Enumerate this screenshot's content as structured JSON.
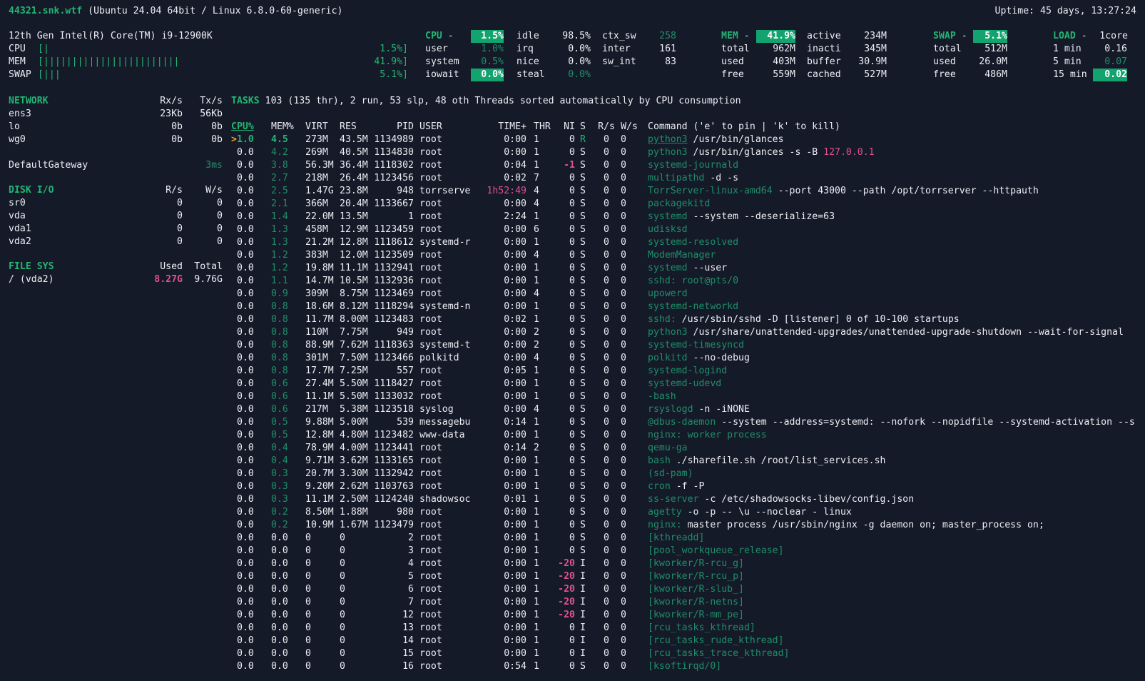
{
  "header": {
    "hostname": "44321.snk.wtf",
    "os": "(Ubuntu 24.04 64bit / Linux 6.8.0-60-generic)",
    "uptime": "Uptime: 45 days, 13:27:24"
  },
  "quicklook": {
    "cpu_model": "12th Gen Intel(R) Core(TM) i9-12900K",
    "bars": [
      {
        "label": "CPU",
        "bar": "[|",
        "value": "1.5%]"
      },
      {
        "label": "MEM",
        "bar": "[||||||||||||||||||||||||",
        "value": "41.9%]"
      },
      {
        "label": "SWAP",
        "bar": "[|||",
        "value": "5.1%]"
      }
    ]
  },
  "cpu": {
    "title": "CPU",
    "dash": "-",
    "total": "1.5%",
    "col1": [
      {
        "k": "user",
        "v": "1.0%"
      },
      {
        "k": "system",
        "v": "0.5%"
      },
      {
        "k": "iowait",
        "v": "0.0%"
      }
    ],
    "col2": [
      {
        "k": "idle",
        "v": "98.5%"
      },
      {
        "k": "irq",
        "v": "0.0%"
      },
      {
        "k": "nice",
        "v": "0.0%"
      },
      {
        "k": "steal",
        "v": "0.0%"
      }
    ],
    "col3": [
      {
        "k": "ctx_sw",
        "v": "258"
      },
      {
        "k": "inter",
        "v": "161"
      },
      {
        "k": "sw_int",
        "v": "83"
      }
    ]
  },
  "mem": {
    "title": "MEM",
    "dash": "-",
    "percent": "41.9%",
    "col1": [
      {
        "k": "total",
        "v": "962M"
      },
      {
        "k": "used",
        "v": "403M"
      },
      {
        "k": "free",
        "v": "559M"
      }
    ],
    "col2": [
      {
        "k": "active",
        "v": "234M"
      },
      {
        "k": "inacti",
        "v": "345M"
      },
      {
        "k": "buffer",
        "v": "30.9M"
      },
      {
        "k": "cached",
        "v": "527M"
      }
    ]
  },
  "swap": {
    "title": "SWAP",
    "dash": "-",
    "percent": "5.1%",
    "rows": [
      {
        "k": "total",
        "v": "512M"
      },
      {
        "k": "used",
        "v": "26.0M"
      },
      {
        "k": "free",
        "v": "486M"
      }
    ]
  },
  "load": {
    "title": "LOAD",
    "dash": "-",
    "cores": "1core",
    "rows": [
      {
        "k": "1 min",
        "v": "0.16"
      },
      {
        "k": "5 min",
        "v": "0.07"
      },
      {
        "k": "15 min",
        "v": "0.02"
      }
    ]
  },
  "network": {
    "title": "NETWORK",
    "rx": "Rx/s",
    "tx": "Tx/s",
    "rows": [
      {
        "name": "ens3",
        "rx": "23Kb",
        "tx": "56Kb"
      },
      {
        "name": "lo",
        "rx": "0b",
        "tx": "0b"
      },
      {
        "name": "wg0",
        "rx": "0b",
        "tx": "0b"
      }
    ]
  },
  "gateway": {
    "label": "DefaultGateway",
    "value": "3ms"
  },
  "diskio": {
    "title": "DISK I/O",
    "r": "R/s",
    "w": "W/s",
    "rows": [
      {
        "name": "sr0",
        "r": "0",
        "w": "0"
      },
      {
        "name": "vda",
        "r": "0",
        "w": "0"
      },
      {
        "name": "vda1",
        "r": "0",
        "w": "0"
      },
      {
        "name": "vda2",
        "r": "0",
        "w": "0"
      }
    ]
  },
  "filesys": {
    "title": "FILE SYS",
    "used": "Used",
    "total": "Total",
    "rows": [
      {
        "name": "/ (vda2)",
        "used": "8.27G",
        "total": "9.76G"
      }
    ]
  },
  "tasks": {
    "label": "TASKS",
    "summary": "103 (135 thr), 2 run, 53 slp, 48 oth Threads sorted automatically by CPU consumption"
  },
  "process_table": {
    "headers": {
      "cpu": "CPU%",
      "mem": "MEM%",
      "virt": "VIRT",
      "res": "RES",
      "pid": "PID",
      "user": "USER",
      "time": "TIME+",
      "thr": "THR",
      "ni": "NI",
      "s": "S",
      "rs": "R/s",
      "ws": "W/s",
      "cmd": "Command ('e' to pin | 'k' to kill)"
    },
    "marker": ">",
    "rows": [
      {
        "cpu": "1.0",
        "mem": "4.5",
        "virt": "273M",
        "res": "43.5M",
        "pid": "1134989",
        "user": "root",
        "time": "0:00",
        "thr": "1",
        "ni": "0",
        "s": "R",
        "rs": "0",
        "ws": "0",
        "prog": "python3",
        "args": "/usr/bin/glances"
      },
      {
        "cpu": "0.0",
        "mem": "4.2",
        "virt": "269M",
        "res": "40.5M",
        "pid": "1134830",
        "user": "root",
        "time": "0:00",
        "thr": "1",
        "ni": "0",
        "s": "S",
        "rs": "0",
        "ws": "0",
        "prog": "python3",
        "args": "/usr/bin/glances -s -B ",
        "extra": "127.0.0.1"
      },
      {
        "cpu": "0.0",
        "mem": "3.8",
        "virt": "56.3M",
        "res": "36.4M",
        "pid": "1118302",
        "user": "root",
        "time": "0:04",
        "thr": "1",
        "ni": "-1",
        "s": "S",
        "rs": "0",
        "ws": "0",
        "prog": "systemd-journald",
        "args": ""
      },
      {
        "cpu": "0.0",
        "mem": "2.7",
        "virt": "218M",
        "res": "26.4M",
        "pid": "1123456",
        "user": "root",
        "time": "0:02",
        "thr": "7",
        "ni": "0",
        "s": "S",
        "rs": "0",
        "ws": "0",
        "prog": "multipathd",
        "args": "-d -s"
      },
      {
        "cpu": "0.0",
        "mem": "2.5",
        "virt": "1.47G",
        "res": "23.8M",
        "pid": "948",
        "user": "torrserve",
        "time": "1h52:49",
        "thr": "4",
        "ni": "0",
        "s": "S",
        "rs": "0",
        "ws": "0",
        "prog": "TorrServer-linux-amd64",
        "args": "--port 43000 --path /opt/torrserver --httpauth"
      },
      {
        "cpu": "0.0",
        "mem": "2.1",
        "virt": "366M",
        "res": "20.4M",
        "pid": "1133667",
        "user": "root",
        "time": "0:00",
        "thr": "4",
        "ni": "0",
        "s": "S",
        "rs": "0",
        "ws": "0",
        "prog": "packagekitd",
        "args": ""
      },
      {
        "cpu": "0.0",
        "mem": "1.4",
        "virt": "22.0M",
        "res": "13.5M",
        "pid": "1",
        "user": "root",
        "time": "2:24",
        "thr": "1",
        "ni": "0",
        "s": "S",
        "rs": "0",
        "ws": "0",
        "prog": "systemd",
        "args": "--system --deserialize=63"
      },
      {
        "cpu": "0.0",
        "mem": "1.3",
        "virt": "458M",
        "res": "12.9M",
        "pid": "1123459",
        "user": "root",
        "time": "0:00",
        "thr": "6",
        "ni": "0",
        "s": "S",
        "rs": "0",
        "ws": "0",
        "prog": "udisksd",
        "args": ""
      },
      {
        "cpu": "0.0",
        "mem": "1.3",
        "virt": "21.2M",
        "res": "12.8M",
        "pid": "1118612",
        "user": "systemd-r",
        "time": "0:00",
        "thr": "1",
        "ni": "0",
        "s": "S",
        "rs": "0",
        "ws": "0",
        "prog": "systemd-resolved",
        "args": ""
      },
      {
        "cpu": "0.0",
        "mem": "1.2",
        "virt": "383M",
        "res": "12.0M",
        "pid": "1123509",
        "user": "root",
        "time": "0:00",
        "thr": "4",
        "ni": "0",
        "s": "S",
        "rs": "0",
        "ws": "0",
        "prog": "ModemManager",
        "args": ""
      },
      {
        "cpu": "0.0",
        "mem": "1.2",
        "virt": "19.8M",
        "res": "11.1M",
        "pid": "1132941",
        "user": "root",
        "time": "0:00",
        "thr": "1",
        "ni": "0",
        "s": "S",
        "rs": "0",
        "ws": "0",
        "prog": "systemd",
        "args": "--user"
      },
      {
        "cpu": "0.0",
        "mem": "1.1",
        "virt": "14.7M",
        "res": "10.5M",
        "pid": "1132936",
        "user": "root",
        "time": "0:00",
        "thr": "1",
        "ni": "0",
        "s": "S",
        "rs": "0",
        "ws": "0",
        "prog": "sshd: root@pts/0",
        "args": ""
      },
      {
        "cpu": "0.0",
        "mem": "0.9",
        "virt": "309M",
        "res": "8.75M",
        "pid": "1123469",
        "user": "root",
        "time": "0:00",
        "thr": "4",
        "ni": "0",
        "s": "S",
        "rs": "0",
        "ws": "0",
        "prog": "upowerd",
        "args": ""
      },
      {
        "cpu": "0.0",
        "mem": "0.8",
        "virt": "18.6M",
        "res": "8.12M",
        "pid": "1118294",
        "user": "systemd-n",
        "time": "0:00",
        "thr": "1",
        "ni": "0",
        "s": "S",
        "rs": "0",
        "ws": "0",
        "prog": "systemd-networkd",
        "args": ""
      },
      {
        "cpu": "0.0",
        "mem": "0.8",
        "virt": "11.7M",
        "res": "8.00M",
        "pid": "1123483",
        "user": "root",
        "time": "0:02",
        "thr": "1",
        "ni": "0",
        "s": "S",
        "rs": "0",
        "ws": "0",
        "prog": "sshd:",
        "args": "/usr/sbin/sshd -D [listener] 0 of 10-100 startups"
      },
      {
        "cpu": "0.0",
        "mem": "0.8",
        "virt": "110M",
        "res": "7.75M",
        "pid": "949",
        "user": "root",
        "time": "0:00",
        "thr": "2",
        "ni": "0",
        "s": "S",
        "rs": "0",
        "ws": "0",
        "prog": "python3",
        "args": "/usr/share/unattended-upgrades/unattended-upgrade-shutdown --wait-for-signal"
      },
      {
        "cpu": "0.0",
        "mem": "0.8",
        "virt": "88.9M",
        "res": "7.62M",
        "pid": "1118363",
        "user": "systemd-t",
        "time": "0:00",
        "thr": "2",
        "ni": "0",
        "s": "S",
        "rs": "0",
        "ws": "0",
        "prog": "systemd-timesyncd",
        "args": ""
      },
      {
        "cpu": "0.0",
        "mem": "0.8",
        "virt": "301M",
        "res": "7.50M",
        "pid": "1123466",
        "user": "polkitd",
        "time": "0:00",
        "thr": "4",
        "ni": "0",
        "s": "S",
        "rs": "0",
        "ws": "0",
        "prog": "polkitd",
        "args": "--no-debug"
      },
      {
        "cpu": "0.0",
        "mem": "0.8",
        "virt": "17.7M",
        "res": "7.25M",
        "pid": "557",
        "user": "root",
        "time": "0:05",
        "thr": "1",
        "ni": "0",
        "s": "S",
        "rs": "0",
        "ws": "0",
        "prog": "systemd-logind",
        "args": ""
      },
      {
        "cpu": "0.0",
        "mem": "0.6",
        "virt": "27.4M",
        "res": "5.50M",
        "pid": "1118427",
        "user": "root",
        "time": "0:00",
        "thr": "1",
        "ni": "0",
        "s": "S",
        "rs": "0",
        "ws": "0",
        "prog": "systemd-udevd",
        "args": ""
      },
      {
        "cpu": "0.0",
        "mem": "0.6",
        "virt": "11.1M",
        "res": "5.50M",
        "pid": "1133032",
        "user": "root",
        "time": "0:00",
        "thr": "1",
        "ni": "0",
        "s": "S",
        "rs": "0",
        "ws": "0",
        "prog": "-bash",
        "args": ""
      },
      {
        "cpu": "0.0",
        "mem": "0.6",
        "virt": "217M",
        "res": "5.38M",
        "pid": "1123518",
        "user": "syslog",
        "time": "0:00",
        "thr": "4",
        "ni": "0",
        "s": "S",
        "rs": "0",
        "ws": "0",
        "prog": "rsyslogd",
        "args": "-n -iNONE"
      },
      {
        "cpu": "0.0",
        "mem": "0.5",
        "virt": "9.88M",
        "res": "5.00M",
        "pid": "539",
        "user": "messagebu",
        "time": "0:14",
        "thr": "1",
        "ni": "0",
        "s": "S",
        "rs": "0",
        "ws": "0",
        "prog": "@dbus-daemon",
        "args": "--system --address=systemd: --nofork --nopidfile --systemd-activation --s"
      },
      {
        "cpu": "0.0",
        "mem": "0.5",
        "virt": "12.8M",
        "res": "4.80M",
        "pid": "1123482",
        "user": "www-data",
        "time": "0:00",
        "thr": "1",
        "ni": "0",
        "s": "S",
        "rs": "0",
        "ws": "0",
        "prog": "nginx: worker process",
        "args": ""
      },
      {
        "cpu": "0.0",
        "mem": "0.4",
        "virt": "78.9M",
        "res": "4.00M",
        "pid": "1123441",
        "user": "root",
        "time": "0:14",
        "thr": "2",
        "ni": "0",
        "s": "S",
        "rs": "0",
        "ws": "0",
        "prog": "qemu-ga",
        "args": ""
      },
      {
        "cpu": "0.0",
        "mem": "0.4",
        "virt": "9.71M",
        "res": "3.62M",
        "pid": "1133165",
        "user": "root",
        "time": "0:00",
        "thr": "1",
        "ni": "0",
        "s": "S",
        "rs": "0",
        "ws": "0",
        "prog": "bash",
        "args": "./sharefile.sh /root/list_services.sh"
      },
      {
        "cpu": "0.0",
        "mem": "0.3",
        "virt": "20.7M",
        "res": "3.30M",
        "pid": "1132942",
        "user": "root",
        "time": "0:00",
        "thr": "1",
        "ni": "0",
        "s": "S",
        "rs": "0",
        "ws": "0",
        "prog": "(sd-pam)",
        "args": ""
      },
      {
        "cpu": "0.0",
        "mem": "0.3",
        "virt": "9.20M",
        "res": "2.62M",
        "pid": "1103763",
        "user": "root",
        "time": "0:00",
        "thr": "1",
        "ni": "0",
        "s": "S",
        "rs": "0",
        "ws": "0",
        "prog": "cron",
        "args": "-f -P"
      },
      {
        "cpu": "0.0",
        "mem": "0.3",
        "virt": "11.1M",
        "res": "2.50M",
        "pid": "1124240",
        "user": "shadowsoc",
        "time": "0:01",
        "thr": "1",
        "ni": "0",
        "s": "S",
        "rs": "0",
        "ws": "0",
        "prog": "ss-server",
        "args": "-c /etc/shadowsocks-libev/config.json"
      },
      {
        "cpu": "0.0",
        "mem": "0.2",
        "virt": "8.50M",
        "res": "1.88M",
        "pid": "980",
        "user": "root",
        "time": "0:00",
        "thr": "1",
        "ni": "0",
        "s": "S",
        "rs": "0",
        "ws": "0",
        "prog": "agetty",
        "args": "-o -p -- \\u --noclear - linux"
      },
      {
        "cpu": "0.0",
        "mem": "0.2",
        "virt": "10.9M",
        "res": "1.67M",
        "pid": "1123479",
        "user": "root",
        "time": "0:00",
        "thr": "1",
        "ni": "0",
        "s": "S",
        "rs": "0",
        "ws": "0",
        "prog": "nginx:",
        "args": "master process /usr/sbin/nginx -g daemon on; master_process on;"
      },
      {
        "cpu": "0.0",
        "mem": "0.0",
        "virt": "0",
        "res": "0",
        "pid": "2",
        "user": "root",
        "time": "0:00",
        "thr": "1",
        "ni": "0",
        "s": "S",
        "rs": "0",
        "ws": "0",
        "prog": "[kthreadd]",
        "args": ""
      },
      {
        "cpu": "0.0",
        "mem": "0.0",
        "virt": "0",
        "res": "0",
        "pid": "3",
        "user": "root",
        "time": "0:00",
        "thr": "1",
        "ni": "0",
        "s": "S",
        "rs": "0",
        "ws": "0",
        "prog": "[pool_workqueue_release]",
        "args": ""
      },
      {
        "cpu": "0.0",
        "mem": "0.0",
        "virt": "0",
        "res": "0",
        "pid": "4",
        "user": "root",
        "time": "0:00",
        "thr": "1",
        "ni": "-20",
        "s": "I",
        "rs": "0",
        "ws": "0",
        "prog": "[kworker/R-rcu_g]",
        "args": ""
      },
      {
        "cpu": "0.0",
        "mem": "0.0",
        "virt": "0",
        "res": "0",
        "pid": "5",
        "user": "root",
        "time": "0:00",
        "thr": "1",
        "ni": "-20",
        "s": "I",
        "rs": "0",
        "ws": "0",
        "prog": "[kworker/R-rcu_p]",
        "args": ""
      },
      {
        "cpu": "0.0",
        "mem": "0.0",
        "virt": "0",
        "res": "0",
        "pid": "6",
        "user": "root",
        "time": "0:00",
        "thr": "1",
        "ni": "-20",
        "s": "I",
        "rs": "0",
        "ws": "0",
        "prog": "[kworker/R-slub_]",
        "args": ""
      },
      {
        "cpu": "0.0",
        "mem": "0.0",
        "virt": "0",
        "res": "0",
        "pid": "7",
        "user": "root",
        "time": "0:00",
        "thr": "1",
        "ni": "-20",
        "s": "I",
        "rs": "0",
        "ws": "0",
        "prog": "[kworker/R-netns]",
        "args": ""
      },
      {
        "cpu": "0.0",
        "mem": "0.0",
        "virt": "0",
        "res": "0",
        "pid": "12",
        "user": "root",
        "time": "0:00",
        "thr": "1",
        "ni": "-20",
        "s": "I",
        "rs": "0",
        "ws": "0",
        "prog": "[kworker/R-mm_pe]",
        "args": ""
      },
      {
        "cpu": "0.0",
        "mem": "0.0",
        "virt": "0",
        "res": "0",
        "pid": "13",
        "user": "root",
        "time": "0:00",
        "thr": "1",
        "ni": "0",
        "s": "I",
        "rs": "0",
        "ws": "0",
        "prog": "[rcu_tasks_kthread]",
        "args": ""
      },
      {
        "cpu": "0.0",
        "mem": "0.0",
        "virt": "0",
        "res": "0",
        "pid": "14",
        "user": "root",
        "time": "0:00",
        "thr": "1",
        "ni": "0",
        "s": "I",
        "rs": "0",
        "ws": "0",
        "prog": "[rcu_tasks_rude_kthread]",
        "args": ""
      },
      {
        "cpu": "0.0",
        "mem": "0.0",
        "virt": "0",
        "res": "0",
        "pid": "15",
        "user": "root",
        "time": "0:00",
        "thr": "1",
        "ni": "0",
        "s": "I",
        "rs": "0",
        "ws": "0",
        "prog": "[rcu_tasks_trace_kthread]",
        "args": ""
      },
      {
        "cpu": "0.0",
        "mem": "0.0",
        "virt": "0",
        "res": "0",
        "pid": "16",
        "user": "root",
        "time": "0:54",
        "thr": "1",
        "ni": "0",
        "s": "S",
        "rs": "0",
        "ws": "0",
        "prog": "[ksoftirqd/0]",
        "args": ""
      }
    ]
  },
  "colors": {
    "background": "#151a29",
    "text": "#ededf2",
    "green": "#22b573",
    "dim_green": "#1f8d68",
    "highlight": "#13a36e",
    "magenta": "#e0508f"
  }
}
